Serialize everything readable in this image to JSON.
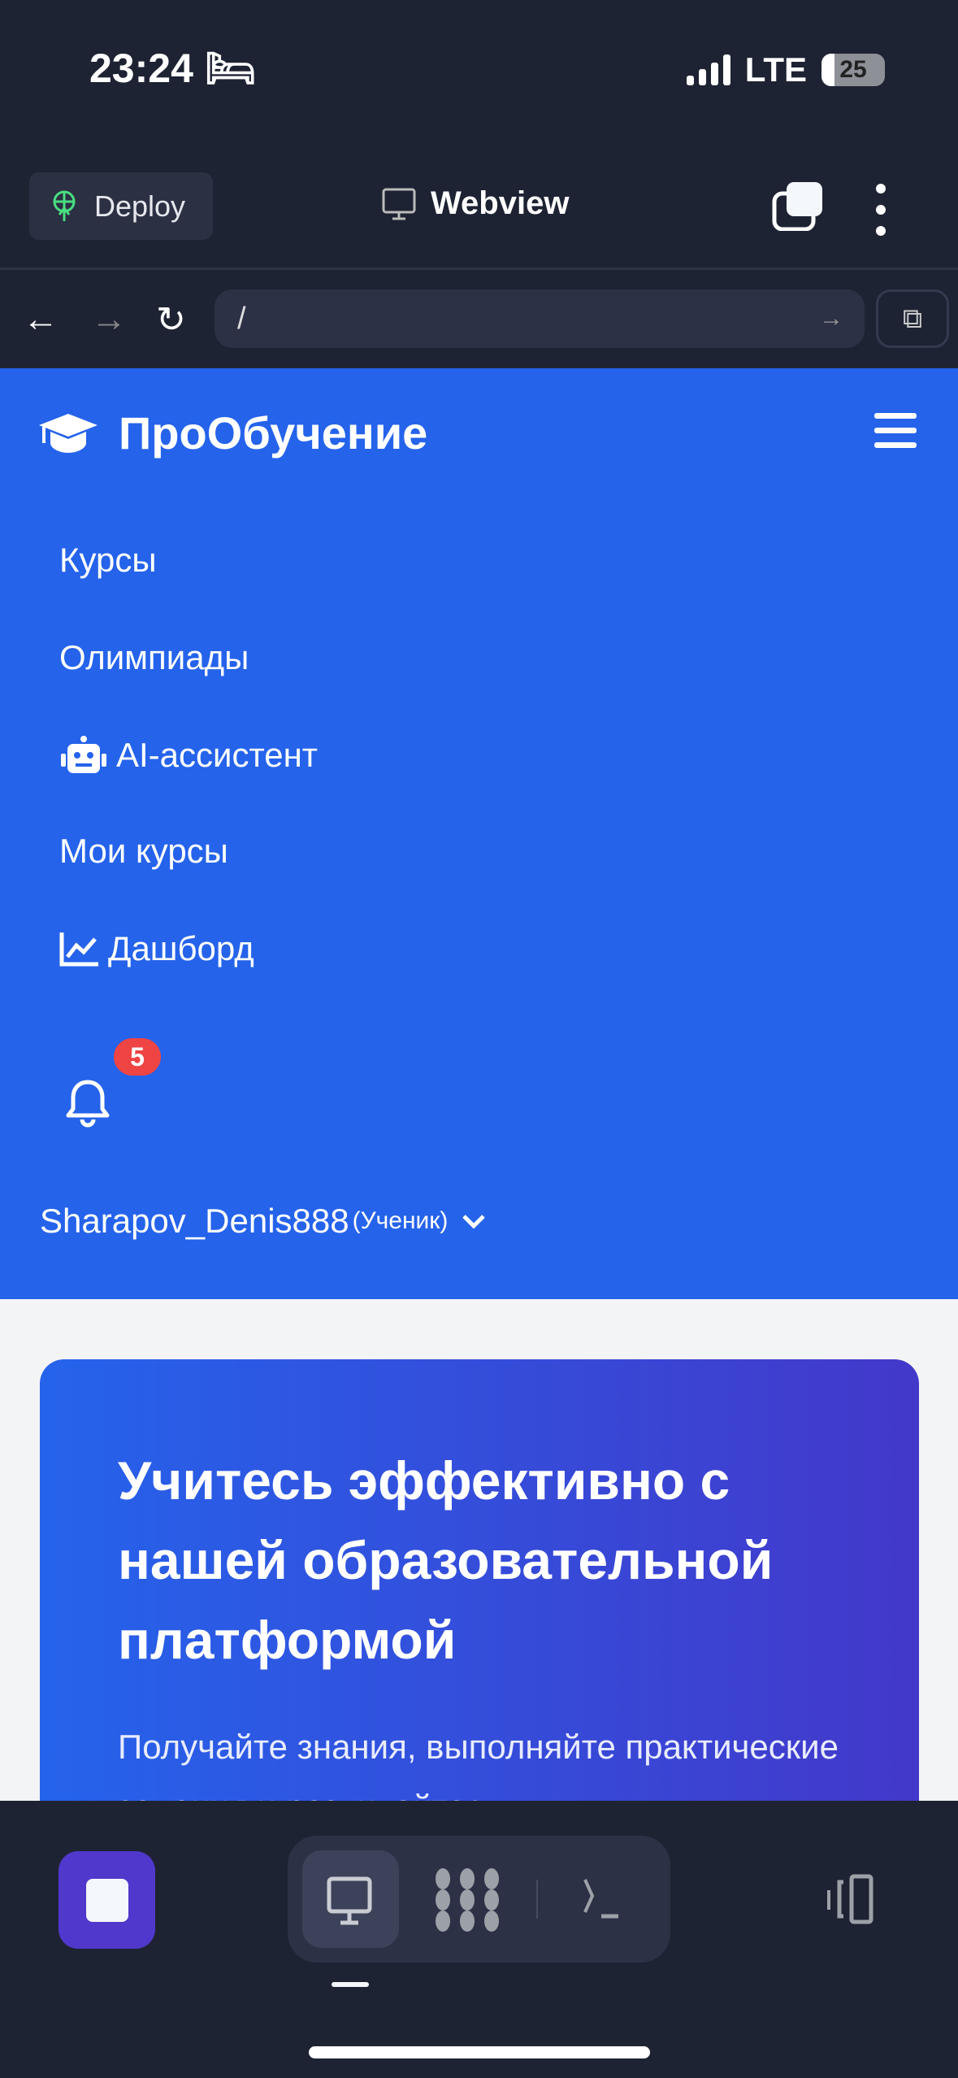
{
  "status_bar": {
    "time": "23:24",
    "network": "LTE",
    "battery": "25"
  },
  "toolbar": {
    "deploy_label": "Deploy",
    "title": "Webview"
  },
  "address_bar": {
    "url": "/"
  },
  "site": {
    "brand": "ПроОбучение",
    "menu": [
      {
        "label": "Курсы",
        "icon": ""
      },
      {
        "label": "Олимпиады",
        "icon": ""
      },
      {
        "label": "AI-ассистент",
        "icon": "robot-icon"
      },
      {
        "label": "Мои курсы",
        "icon": ""
      },
      {
        "label": "Дашборд",
        "icon": "chart-line-icon"
      }
    ],
    "notifications_count": "5",
    "user": {
      "name": "Sharapov_Denis888",
      "role": "(Ученик)"
    }
  },
  "hero": {
    "title": "Учитесь эффективно с нашей образовательной платформой",
    "subtitle": "Получайте знания, выполняйте практические задания и развивайтесь"
  },
  "colors": {
    "header": "#2563eb",
    "hero_end": "#4338ca",
    "badge": "#ef4444",
    "stop_button": "#5038cc"
  }
}
